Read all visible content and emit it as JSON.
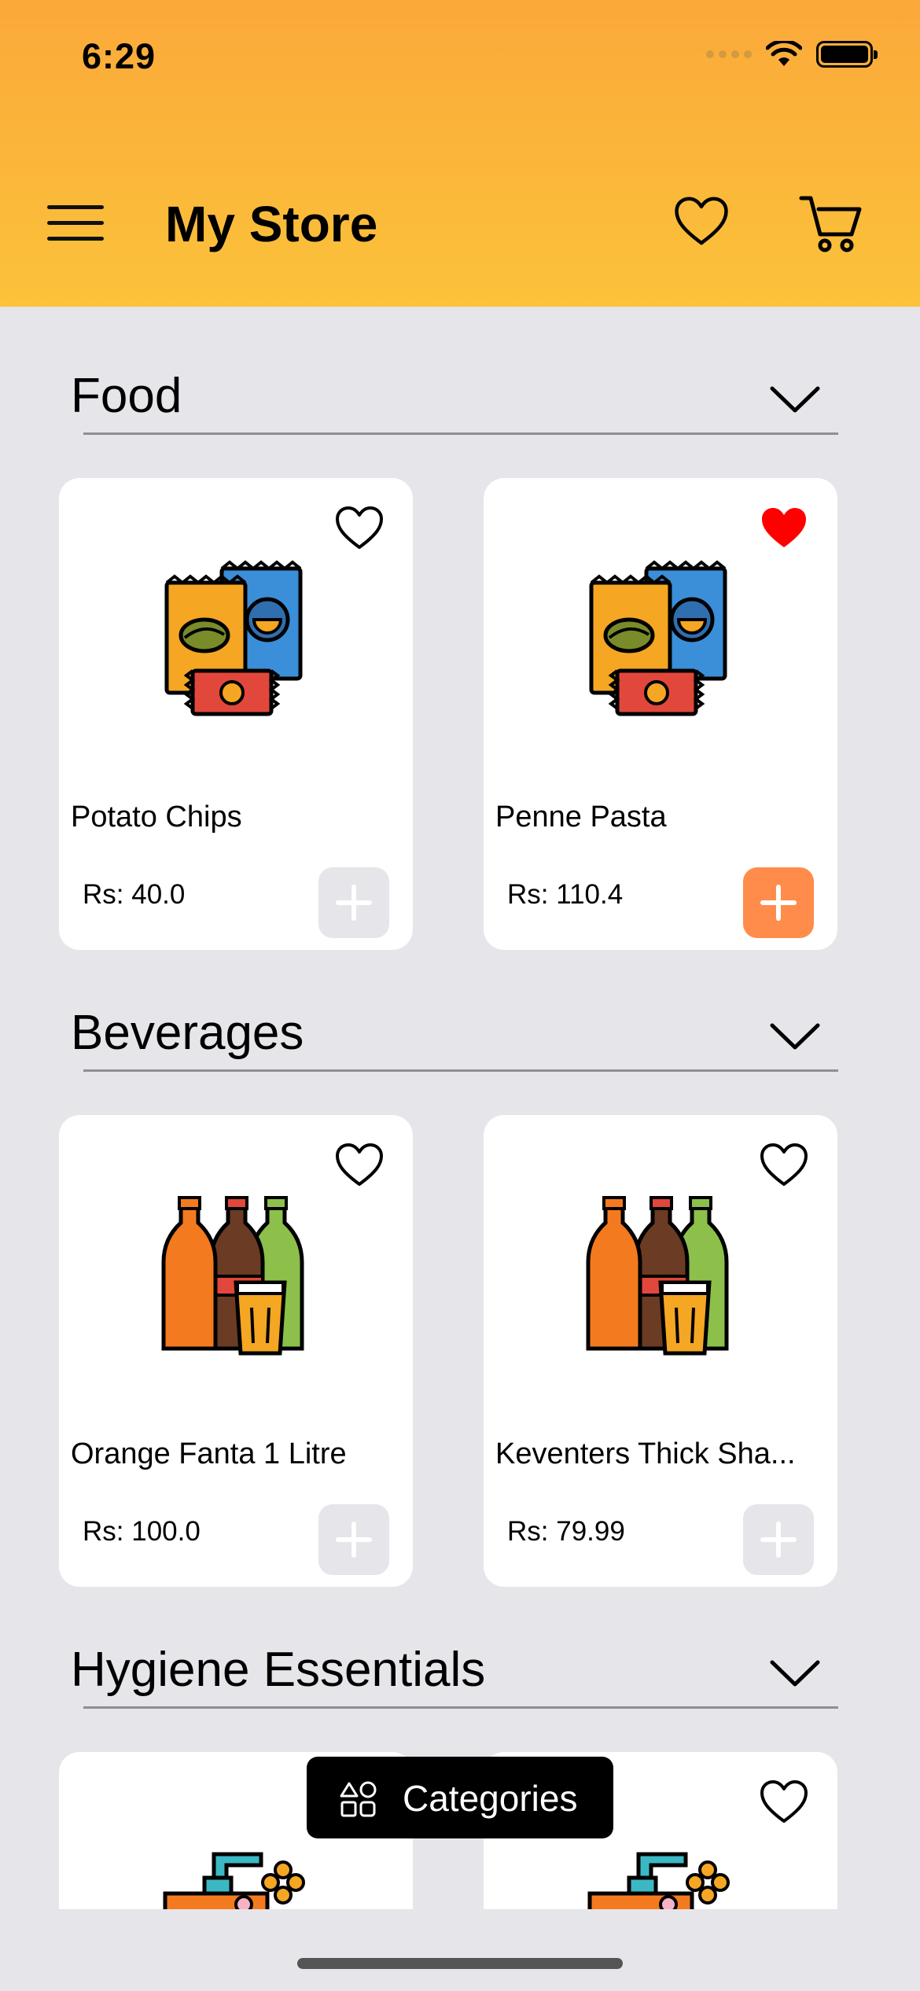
{
  "status": {
    "time": "6:29"
  },
  "header": {
    "title": "My Store"
  },
  "sections": [
    {
      "title": "Food",
      "products": [
        {
          "name": "Potato Chips",
          "price": "Rs: 40.0",
          "favorite": false,
          "in_cart": false,
          "image": "snacks-icon"
        },
        {
          "name": "Penne Pasta",
          "price": "Rs: 110.4",
          "favorite": true,
          "in_cart": true,
          "image": "snacks-icon"
        }
      ]
    },
    {
      "title": "Beverages",
      "products": [
        {
          "name": "Orange Fanta 1 Litre",
          "price": "Rs: 100.0",
          "favorite": false,
          "in_cart": false,
          "image": "bottles-icon"
        },
        {
          "name": "Keventers Thick Sha...",
          "price": "Rs: 79.99",
          "favorite": false,
          "in_cart": false,
          "image": "bottles-icon"
        }
      ]
    },
    {
      "title": "Hygiene Essentials",
      "products": [
        {
          "favorite": false,
          "image": "soap-dispenser-icon"
        },
        {
          "favorite": false,
          "image": "soap-dispenser-icon"
        }
      ]
    }
  ],
  "categories_button": {
    "label": "Categories"
  },
  "colors": {
    "header_top": "#fba93a",
    "header_bottom": "#fbc23a",
    "accent": "#ff8c4b",
    "favorite": "#ff0000",
    "background": "#e5e5ea"
  }
}
